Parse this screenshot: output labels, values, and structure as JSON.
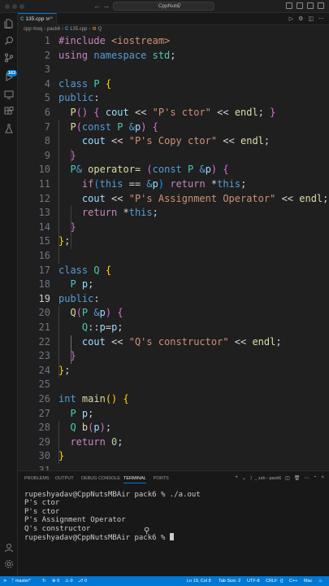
{
  "window": {
    "title": "CppNuts"
  },
  "tab": {
    "label": "135.cpp",
    "modified": "M",
    "close": "×"
  },
  "breadcrumb": [
    "cpp moq",
    "pack6",
    "135.cpp",
    "Q"
  ],
  "editor": {
    "lines": [
      {
        "n": "1",
        "t": [
          [
            "inc",
            "#include "
          ],
          [
            "str",
            "<iostream>"
          ]
        ]
      },
      {
        "n": "2",
        "t": [
          [
            "ctrl",
            "using "
          ],
          [
            "kw",
            "namespace "
          ],
          [
            "ty",
            "std"
          ],
          [
            "pl",
            ";"
          ]
        ]
      },
      {
        "n": "3",
        "t": []
      },
      {
        "n": "4",
        "t": [
          [
            "kw",
            "class "
          ],
          [
            "ty",
            "P "
          ],
          [
            "b1",
            "{"
          ]
        ]
      },
      {
        "n": "5",
        "t": [
          [
            "kw",
            "public"
          ],
          [
            "pl",
            ":"
          ]
        ]
      },
      {
        "n": "6",
        "t": [
          [
            "pl",
            "  "
          ],
          [
            "fn",
            "P"
          ],
          [
            "b2",
            "()"
          ],
          [
            "pl",
            " "
          ],
          [
            "b2",
            "{"
          ],
          [
            "pl",
            " "
          ],
          [
            "var",
            "cout"
          ],
          [
            "op",
            " << "
          ],
          [
            "str",
            "\"P's ctor\""
          ],
          [
            "op",
            " << "
          ],
          [
            "fn",
            "endl"
          ],
          [
            "pl",
            "; "
          ],
          [
            "b2",
            "}"
          ]
        ]
      },
      {
        "n": "7",
        "t": [
          [
            "pl",
            "  "
          ],
          [
            "fn",
            "P"
          ],
          [
            "b2",
            "("
          ],
          [
            "kw",
            "const "
          ],
          [
            "ty",
            "P "
          ],
          [
            "kw",
            "&"
          ],
          [
            "var",
            "p"
          ],
          [
            "b2",
            ")"
          ],
          [
            "pl",
            " "
          ],
          [
            "b2",
            "{"
          ]
        ]
      },
      {
        "n": "8",
        "t": [
          [
            "pl",
            "    "
          ],
          [
            "var",
            "cout"
          ],
          [
            "op",
            " << "
          ],
          [
            "str",
            "\"P's Copy ctor\""
          ],
          [
            "op",
            " << "
          ],
          [
            "fn",
            "endl"
          ],
          [
            "pl",
            ";"
          ]
        ]
      },
      {
        "n": "9",
        "t": [
          [
            "pl",
            "  "
          ],
          [
            "b2",
            "}"
          ]
        ]
      },
      {
        "n": "10",
        "t": [
          [
            "pl",
            "  "
          ],
          [
            "ty",
            "P"
          ],
          [
            "kw",
            "& "
          ],
          [
            "fn",
            "operator="
          ],
          [
            "pl",
            " "
          ],
          [
            "b2",
            "("
          ],
          [
            "kw",
            "const "
          ],
          [
            "ty",
            "P "
          ],
          [
            "kw",
            "&"
          ],
          [
            "var",
            "p"
          ],
          [
            "b2",
            ")"
          ],
          [
            "pl",
            " "
          ],
          [
            "b2",
            "{"
          ]
        ]
      },
      {
        "n": "11",
        "t": [
          [
            "pl",
            "    "
          ],
          [
            "ctrl",
            "if"
          ],
          [
            "b3",
            "("
          ],
          [
            "kw",
            "this"
          ],
          [
            "op",
            " == "
          ],
          [
            "kw",
            "&"
          ],
          [
            "var",
            "p"
          ],
          [
            "b3",
            ")"
          ],
          [
            "pl",
            " "
          ],
          [
            "ctrl",
            "return "
          ],
          [
            "op",
            "*"
          ],
          [
            "kw",
            "this"
          ],
          [
            "pl",
            ";"
          ]
        ]
      },
      {
        "n": "12",
        "t": [
          [
            "pl",
            "    "
          ],
          [
            "var",
            "cout"
          ],
          [
            "op",
            " << "
          ],
          [
            "str",
            "\"P's Assignment Operator\""
          ],
          [
            "op",
            " << "
          ],
          [
            "fn",
            "endl"
          ],
          [
            "pl",
            ";"
          ]
        ]
      },
      {
        "n": "13",
        "t": [
          [
            "pl",
            "    "
          ],
          [
            "ctrl",
            "return "
          ],
          [
            "op",
            "*"
          ],
          [
            "kw",
            "this"
          ],
          [
            "pl",
            ";"
          ]
        ]
      },
      {
        "n": "14",
        "t": [
          [
            "pl",
            "  "
          ],
          [
            "b2",
            "}"
          ]
        ]
      },
      {
        "n": "15",
        "t": [
          [
            "b1",
            "}"
          ],
          [
            "pl",
            ";"
          ]
        ]
      },
      {
        "n": "16",
        "t": []
      },
      {
        "n": "17",
        "t": [
          [
            "kw",
            "class "
          ],
          [
            "ty",
            "Q "
          ],
          [
            "b1",
            "{"
          ]
        ]
      },
      {
        "n": "18",
        "t": [
          [
            "pl",
            "  "
          ],
          [
            "ty",
            "P "
          ],
          [
            "var",
            "p"
          ],
          [
            "pl",
            ";"
          ]
        ]
      },
      {
        "n": "19",
        "t": [
          [
            "kw",
            "public"
          ],
          [
            "pl",
            ":"
          ]
        ]
      },
      {
        "n": "20",
        "t": [
          [
            "pl",
            "  "
          ],
          [
            "fn",
            "Q"
          ],
          [
            "b2",
            "("
          ],
          [
            "ty",
            "P "
          ],
          [
            "kw",
            "&"
          ],
          [
            "var",
            "p"
          ],
          [
            "b2",
            ")"
          ],
          [
            "pl",
            " "
          ],
          [
            "b2",
            "{"
          ]
        ]
      },
      {
        "n": "21",
        "t": [
          [
            "pl",
            "    "
          ],
          [
            "ty",
            "Q"
          ],
          [
            "pl",
            "::"
          ],
          [
            "var",
            "p"
          ],
          [
            "op",
            "="
          ],
          [
            "var",
            "p"
          ],
          [
            "pl",
            ";"
          ]
        ]
      },
      {
        "n": "22",
        "t": [
          [
            "pl",
            "    "
          ],
          [
            "var",
            "cout"
          ],
          [
            "op",
            " << "
          ],
          [
            "str",
            "\"Q's constructor\""
          ],
          [
            "op",
            " << "
          ],
          [
            "fn",
            "endl"
          ],
          [
            "pl",
            ";"
          ]
        ]
      },
      {
        "n": "23",
        "t": [
          [
            "pl",
            "  "
          ],
          [
            "b2",
            "}"
          ]
        ]
      },
      {
        "n": "24",
        "t": [
          [
            "b1",
            "}"
          ],
          [
            "pl",
            ";"
          ]
        ]
      },
      {
        "n": "25",
        "t": []
      },
      {
        "n": "26",
        "t": [
          [
            "kw",
            "int "
          ],
          [
            "fn",
            "main"
          ],
          [
            "b1",
            "()"
          ],
          [
            "pl",
            " "
          ],
          [
            "b1",
            "{"
          ]
        ]
      },
      {
        "n": "27",
        "t": [
          [
            "pl",
            "  "
          ],
          [
            "ty",
            "P "
          ],
          [
            "var",
            "p"
          ],
          [
            "pl",
            ";"
          ]
        ]
      },
      {
        "n": "28",
        "t": [
          [
            "pl",
            "  "
          ],
          [
            "ty",
            "Q "
          ],
          [
            "fn",
            "b"
          ],
          [
            "b2",
            "("
          ],
          [
            "var",
            "p"
          ],
          [
            "b2",
            ")"
          ],
          [
            "pl",
            ";"
          ]
        ]
      },
      {
        "n": "29",
        "t": [
          [
            "pl",
            "  "
          ],
          [
            "ctrl",
            "return "
          ],
          [
            "num",
            "0"
          ],
          [
            "pl",
            ";"
          ]
        ]
      },
      {
        "n": "30",
        "t": [
          [
            "b1",
            "}"
          ]
        ]
      },
      {
        "n": "31",
        "t": []
      }
    ],
    "active_line": "19"
  },
  "panel": {
    "tabs": [
      "PROBLEMS",
      "OUTPUT",
      "DEBUG CONSOLE",
      "TERMINAL",
      "PORTS"
    ],
    "active_tab": "TERMINAL",
    "terminal_name": "zsh - pack6",
    "terminal_lines": [
      "rupeshyadav@CppNutsMBAir pack6 % ./a.out",
      "P's ctor",
      "P's ctor",
      "P's Assignment Operator",
      "Q's constructor",
      "rupeshyadav@CppNutsMBAir pack6 % "
    ]
  },
  "statusbar": {
    "branch": "master*",
    "sync": "↻",
    "errors": "⊗ 0",
    "warnings": "⚠ 0",
    "ports": "⎇ 0",
    "position": "Ln 19, Col 8",
    "spaces": "Tab Size: 2",
    "encoding": "UTF-8",
    "eol": "CRLF",
    "braces": "{}",
    "language": "C++",
    "platform": "Mac",
    "bell": "🔔"
  },
  "colors": {
    "accent": "#0078d4",
    "editor_bg": "#1f1f1f",
    "panel_bg": "#181818"
  }
}
